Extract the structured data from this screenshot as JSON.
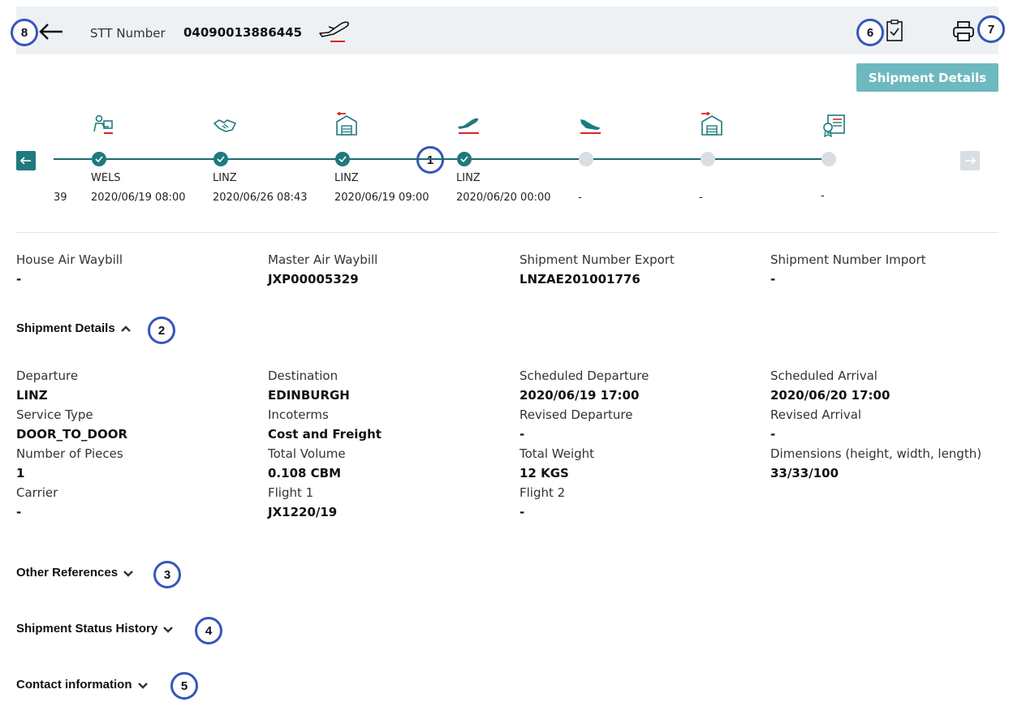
{
  "header": {
    "stt_label": "STT Number",
    "stt_number": "04090013886445",
    "icons": [
      "back-arrow-icon",
      "plane-departure-icon",
      "clipboard-check-icon",
      "printer-icon"
    ]
  },
  "badges": [
    "1",
    "2",
    "3",
    "4",
    "5",
    "6",
    "7",
    "8"
  ],
  "shipment_details_button": "Shipment Details",
  "timeline": {
    "leading_number": "39",
    "steps": [
      {
        "icon": "pickup-person-icon",
        "status": "done",
        "location": "WELS",
        "time": "2020/06/19 08:00"
      },
      {
        "icon": "handshake-icon",
        "status": "done",
        "location": "LINZ",
        "time": "2020/06/26 08:43"
      },
      {
        "icon": "warehouse-out-icon",
        "status": "done",
        "location": "LINZ",
        "time": "2020/06/19 09:00"
      },
      {
        "icon": "plane-departure-icon",
        "status": "done",
        "location": "LINZ",
        "time": "2020/06/20 00:00"
      },
      {
        "icon": "plane-arrival-icon",
        "status": "pending",
        "location": "",
        "time": "-"
      },
      {
        "icon": "warehouse-in-icon",
        "status": "pending",
        "location": "",
        "time": "-"
      },
      {
        "icon": "certificate-icon",
        "status": "pending",
        "location": "",
        "time": "-"
      }
    ]
  },
  "references": [
    {
      "label": "House Air Waybill",
      "value": "-"
    },
    {
      "label": "Master Air Waybill",
      "value": "JXP00005329"
    },
    {
      "label": "Shipment Number Export",
      "value": "LNZAE201001776"
    },
    {
      "label": "Shipment Number Import",
      "value": "-"
    }
  ],
  "sections": {
    "shipment_details": "Shipment Details",
    "other_references": "Other References",
    "status_history": "Shipment Status History",
    "contact_information": "Contact information"
  },
  "details": [
    [
      {
        "label": "Departure",
        "value": "LINZ"
      },
      {
        "label": "Destination",
        "value": "EDINBURGH"
      },
      {
        "label": "Scheduled Departure",
        "value": "2020/06/19 17:00"
      },
      {
        "label": "Scheduled Arrival",
        "value": "2020/06/20 17:00"
      }
    ],
    [
      {
        "label": "Service Type",
        "value": "DOOR_TO_DOOR"
      },
      {
        "label": "Incoterms",
        "value": "Cost and Freight"
      },
      {
        "label": "Revised Departure",
        "value": "-"
      },
      {
        "label": "Revised Arrival",
        "value": "-"
      }
    ],
    [
      {
        "label": "Number of Pieces",
        "value": "1"
      },
      {
        "label": "Total Volume",
        "value": "0.108 CBM"
      },
      {
        "label": "Total Weight",
        "value": "12 KGS"
      },
      {
        "label": "Dimensions (height, width, length)",
        "value": "33/33/100"
      }
    ],
    [
      {
        "label": "Carrier",
        "value": "-"
      },
      {
        "label": "Flight 1",
        "value": "JX1220/19"
      },
      {
        "label": "Flight 2",
        "value": "-"
      }
    ]
  ],
  "colors": {
    "accent": "#1e7a7e",
    "button": "#6db9bf",
    "badge_border": "#3557b8",
    "red_accent": "#d9262b",
    "pending": "#d9dee2"
  }
}
